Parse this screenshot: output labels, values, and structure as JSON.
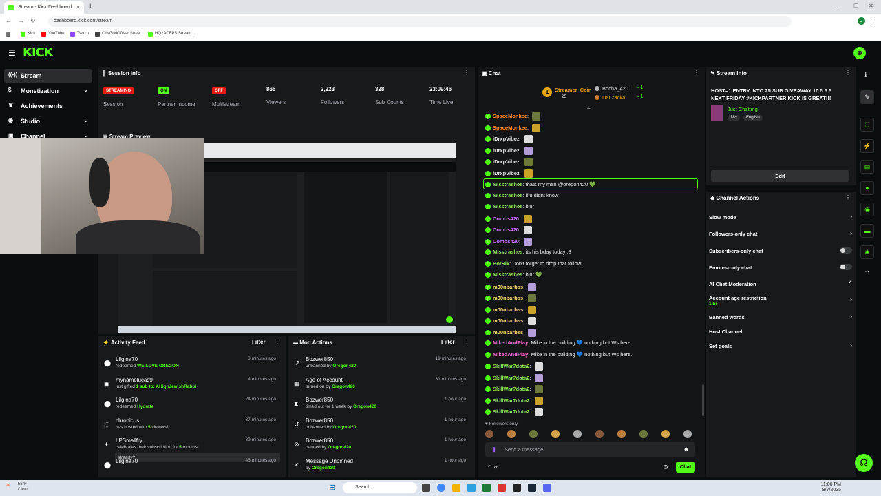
{
  "browser": {
    "tab_title": "Stream - Kick Dashboard",
    "url": "dashboard.kick.com/stream",
    "bookmarks": [
      "Kick",
      "YouTube",
      "Twitch",
      "CrisGodOfWar Strea...",
      "HQ2ACFPS Stream..."
    ]
  },
  "sidebar": {
    "items": [
      {
        "label": "Stream",
        "icon": "broadcast-icon"
      },
      {
        "label": "Monetization",
        "icon": "dollar-icon"
      },
      {
        "label": "Achievements",
        "icon": "trophy-icon"
      },
      {
        "label": "Studio",
        "icon": "studio-icon"
      },
      {
        "label": "Channel",
        "icon": "channel-icon"
      }
    ]
  },
  "session": {
    "title": "Session Info",
    "stats": [
      {
        "value": "STREAMING",
        "label": "Session",
        "badge": "#e91916"
      },
      {
        "value": "ON",
        "label": "Partner Income",
        "badge": "#53fc18"
      },
      {
        "value": "OFF",
        "label": "Multistream",
        "badge": "#e91916"
      },
      {
        "value": "865",
        "label": "Viewers"
      },
      {
        "value": "2,223",
        "label": "Followers"
      },
      {
        "value": "328",
        "label": "Sub Counts"
      },
      {
        "value": "23:09:46",
        "label": "Time Live"
      }
    ]
  },
  "preview": {
    "title": "Stream Preview"
  },
  "activity": {
    "title": "Activity Feed",
    "filter": "Filter",
    "items": [
      {
        "name": "Lilgina70",
        "pre": "redeemed",
        "hl": "WE LOVE OREGON",
        "post": "",
        "time": "3 minutes ago",
        "icon": "redeem-icon"
      },
      {
        "name": "mynamelucas9",
        "pre": "just gifted",
        "hl": "1 sub to: AHighJewishRabbi",
        "post": "",
        "time": "4 minutes ago",
        "icon": "gift-icon"
      },
      {
        "name": "Lilgina70",
        "pre": "redeemed",
        "hl": "Hydrate",
        "post": "",
        "time": "24 minutes ago",
        "icon": "redeem-icon"
      },
      {
        "name": "chronicus",
        "pre": "has hosted with",
        "hl": "5",
        "post": "viewers!",
        "time": "37 minutes ago",
        "icon": "host-icon"
      },
      {
        "name": "LPSmallfry",
        "pre": "celebrates their subscription for",
        "hl": "5",
        "post": "months!",
        "time": "39 minutes ago",
        "icon": "star-icon",
        "quote": "already?"
      },
      {
        "name": "Lilgina70",
        "pre": "",
        "hl": "",
        "post": "",
        "time": "46 minutes ago",
        "icon": "redeem-icon"
      }
    ]
  },
  "mod": {
    "title": "Mod Actions",
    "filter": "Filter",
    "items": [
      {
        "name": "Bozwer850",
        "pre": "unbanned by",
        "hl": "Oregon420",
        "post": "",
        "time": "19 minutes ago",
        "icon": "unban-icon"
      },
      {
        "name": "Age of Account",
        "pre": "turned on by",
        "hl": "Oregon420",
        "post": "",
        "time": "31 minutes ago",
        "icon": "calendar-icon"
      },
      {
        "name": "Bozwer850",
        "pre": "timed out for 1 week by",
        "hl": "Oregon420",
        "post": "",
        "time": "1 hour ago",
        "icon": "hourglass-icon"
      },
      {
        "name": "Bozwer850",
        "pre": "unbanned by",
        "hl": "Oregon420",
        "post": "",
        "time": "1 hour ago",
        "icon": "unban-icon"
      },
      {
        "name": "Bozwer850",
        "pre": "banned by",
        "hl": "Oregon420",
        "post": "",
        "time": "1 hour ago",
        "icon": "ban-icon"
      },
      {
        "name": "Message Unpinned",
        "pre": "by",
        "hl": "Oregon420",
        "post": "",
        "time": "1 hour ago",
        "icon": "pin-icon"
      }
    ]
  },
  "chat": {
    "title": "Chat",
    "top": [
      {
        "name": "Streamer_Coin",
        "count": "25"
      },
      {
        "name": "Bocha_420",
        "count": "1"
      },
      {
        "name": "DaCracka",
        "count": "1"
      }
    ],
    "messages": [
      {
        "name": "SpaceMonkee",
        "color": "#ff8a2a",
        "text": ""
      },
      {
        "name": "SpaceMonkee",
        "color": "#ff8a2a",
        "text": ""
      },
      {
        "name": "iDrxpVibez",
        "color": "#e6e6e6",
        "text": ""
      },
      {
        "name": "iDrxpVibez",
        "color": "#e6e6e6",
        "text": ""
      },
      {
        "name": "iDrxpVibez",
        "color": "#e6e6e6",
        "text": ""
      },
      {
        "name": "iDrxpVibez",
        "color": "#e6e6e6",
        "text": ""
      },
      {
        "name": "Misstrashes",
        "color": "#8ee55a",
        "text": "thats my man @oregon420 💚"
      },
      {
        "name": "Misstrashes",
        "color": "#8ee55a",
        "text": "if u didnt know"
      },
      {
        "name": "Misstrashes",
        "color": "#8ee55a",
        "text": "blur"
      },
      {
        "name": "Combs420",
        "color": "#c86bff",
        "text": ""
      },
      {
        "name": "Combs420",
        "color": "#c86bff",
        "text": ""
      },
      {
        "name": "Combs420",
        "color": "#c86bff",
        "text": ""
      },
      {
        "name": "Misstrashes",
        "color": "#8ee55a",
        "text": "its his bday today :3"
      },
      {
        "name": "BotRix",
        "color": "#8ee55a",
        "text": "Don't forget to drop that follow!"
      },
      {
        "name": "Misstrashes",
        "color": "#8ee55a",
        "text": "blur 💚"
      },
      {
        "name": "m00nbarbss",
        "color": "#f5d76e",
        "text": ""
      },
      {
        "name": "m00nbarbss",
        "color": "#f5d76e",
        "text": ""
      },
      {
        "name": "m00nbarbss",
        "color": "#f5d76e",
        "text": ""
      },
      {
        "name": "m00nbarbss",
        "color": "#f5d76e",
        "text": ""
      },
      {
        "name": "m00nbarbss",
        "color": "#f5d76e",
        "text": ""
      },
      {
        "name": "MikedAndPlay",
        "color": "#ff6bd6",
        "text": "Mike in the building 💙 nothing but Ws here."
      },
      {
        "name": "MikedAndPlay",
        "color": "#ff6bd6",
        "text": "Mike in the building 💙 nothing but Ws here."
      },
      {
        "name": "SkillWar7dota2",
        "color": "#8ee55a",
        "text": ""
      },
      {
        "name": "SkillWar7dota2",
        "color": "#8ee55a",
        "text": ""
      },
      {
        "name": "SkillWar7dota2",
        "color": "#8ee55a",
        "text": ""
      },
      {
        "name": "SkillWar7dota2",
        "color": "#8ee55a",
        "text": ""
      },
      {
        "name": "SkillWar7dota2",
        "color": "#8ee55a",
        "text": ""
      }
    ],
    "followers_only": "Followers only",
    "placeholder": "Send a message",
    "send": "Chat"
  },
  "stream_info": {
    "title": "Stream info",
    "stream_title": "HOST=1 ENTRY INTO 25 SUB GIVEAWAY 10 5 5 5 NEXT FRIDAY #KICKPARTNER KICK IS GREAT!!!",
    "category": "Just Chatting",
    "tags": [
      "18+",
      "English"
    ],
    "edit": "Edit"
  },
  "channel_actions": {
    "title": "Channel Actions",
    "items": [
      {
        "label": "Slow mode",
        "ctrl": "chevron"
      },
      {
        "label": "Followers-only chat",
        "ctrl": "chevron"
      },
      {
        "label": "Subscribers-only chat",
        "ctrl": "toggle"
      },
      {
        "label": "Emotes-only chat",
        "ctrl": "toggle"
      },
      {
        "label": "AI Chat Moderation",
        "ctrl": "external"
      },
      {
        "label": "Account age restriction",
        "sub": "1 hr",
        "ctrl": "chevron"
      },
      {
        "label": "Banned words",
        "ctrl": "chevron"
      },
      {
        "label": "Host Channel",
        "ctrl": "none"
      },
      {
        "label": "Set goals",
        "ctrl": "chevron"
      }
    ]
  },
  "taskbar": {
    "weather_temp": "55°F",
    "weather_text": "Clear",
    "search": "Search",
    "time": "11:06 PM",
    "date": "9/7/2025"
  },
  "colors": {
    "accent": "#53fc18",
    "panel": "#18191b",
    "bg": "#0b0e0f"
  }
}
